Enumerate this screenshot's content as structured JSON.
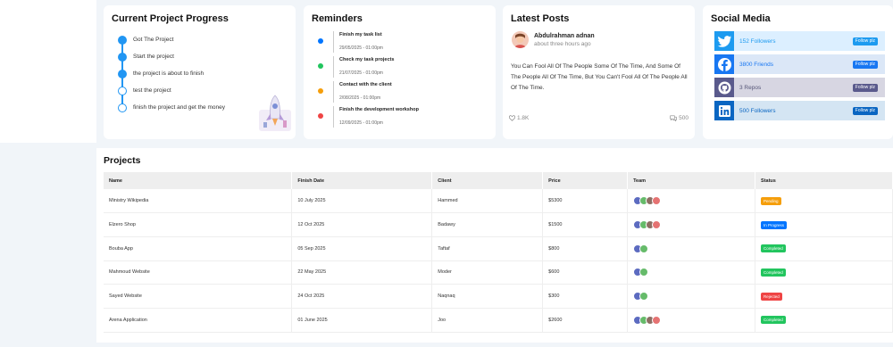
{
  "progress": {
    "title": "Current Project Progress",
    "steps": [
      {
        "label": "Got The Project",
        "done": true
      },
      {
        "label": "Start the project",
        "done": true
      },
      {
        "label": "the project is about to finish",
        "done": true
      },
      {
        "label": "test the project",
        "done": false
      },
      {
        "label": "finish the project and get the money",
        "done": false
      }
    ]
  },
  "reminders": {
    "title": "Reminders",
    "items": [
      {
        "title": "Finish my task list",
        "date": "29/05/2025 - 01:00pm",
        "color": "#0075ff"
      },
      {
        "title": "Check my task projects",
        "date": "21/07/2025 - 01:00pm",
        "color": "#22c55e"
      },
      {
        "title": "Contact with the client",
        "date": "2/08/2025 - 01:00pm",
        "color": "#f59e0b"
      },
      {
        "title": "Finish the development workshop",
        "date": "12/09/2025 - 01:00pm",
        "color": "#ef4444"
      }
    ]
  },
  "posts": {
    "title": "Latest Posts",
    "author": "Abdulrahman adnan",
    "time": "about three hours ago",
    "text": "You Can Fool All Of The People Some Of The Time, And Some Of The People All Of The Time, But You Can't Fool All Of The People All Of The Time.",
    "likes": "1.8K",
    "comments": "500"
  },
  "social": {
    "title": "Social Media",
    "items": [
      {
        "icon": "twitter-icon",
        "text": "152 Followers",
        "button": "Follow plz",
        "icon_bg": "#1d9bf0",
        "bar_bg": "#dcefff",
        "text_color": "#1d9bf0"
      },
      {
        "icon": "facebook-icon",
        "text": "3800 Friends",
        "button": "Follow plz",
        "icon_bg": "#1877f2",
        "bar_bg": "#dbe7f7",
        "text_color": "#1877f2"
      },
      {
        "icon": "github-icon",
        "text": "3 Repos",
        "button": "Follow plz",
        "icon_bg": "#5a5a8c",
        "bar_bg": "#d7d6e2",
        "text_color": "#555577"
      },
      {
        "icon": "linkedin-icon",
        "text": "500 Followers",
        "button": "Follow plz",
        "icon_bg": "#0a66c2",
        "bar_bg": "#d4e5f3",
        "text_color": "#0a66c2"
      }
    ]
  },
  "projects": {
    "title": "Projects",
    "headers": [
      "Name",
      "Finish Date",
      "Client",
      "Price",
      "Team",
      "Status"
    ],
    "rows": [
      {
        "name": "Ministry Wikipedia",
        "date": "10 July 2025",
        "client": "Hammed",
        "price": "$5300",
        "team": 4,
        "status": "Pending",
        "status_color": "#f59e0b"
      },
      {
        "name": "Elzero Shop",
        "date": "12 Oct 2025",
        "client": "Badawy",
        "price": "$1500",
        "team": 4,
        "status": "In Progress",
        "status_color": "#0075ff"
      },
      {
        "name": "Bouba App",
        "date": "05 Sep 2025",
        "client": "Taftaf",
        "price": "$800",
        "team": 2,
        "status": "Completed",
        "status_color": "#22c55e"
      },
      {
        "name": "Mahmoud Website",
        "date": "22 May 2025",
        "client": "Moder",
        "price": "$600",
        "team": 2,
        "status": "Completed",
        "status_color": "#22c55e"
      },
      {
        "name": "Sayed Website",
        "date": "24 Oct 2025",
        "client": "Naqnaq",
        "price": "$300",
        "team": 2,
        "status": "Rejected",
        "status_color": "#ef4444"
      },
      {
        "name": "Arena Application",
        "date": "01 June 2025",
        "client": "Joo",
        "price": "$2600",
        "team": 4,
        "status": "Completed",
        "status_color": "#22c55e"
      }
    ]
  }
}
